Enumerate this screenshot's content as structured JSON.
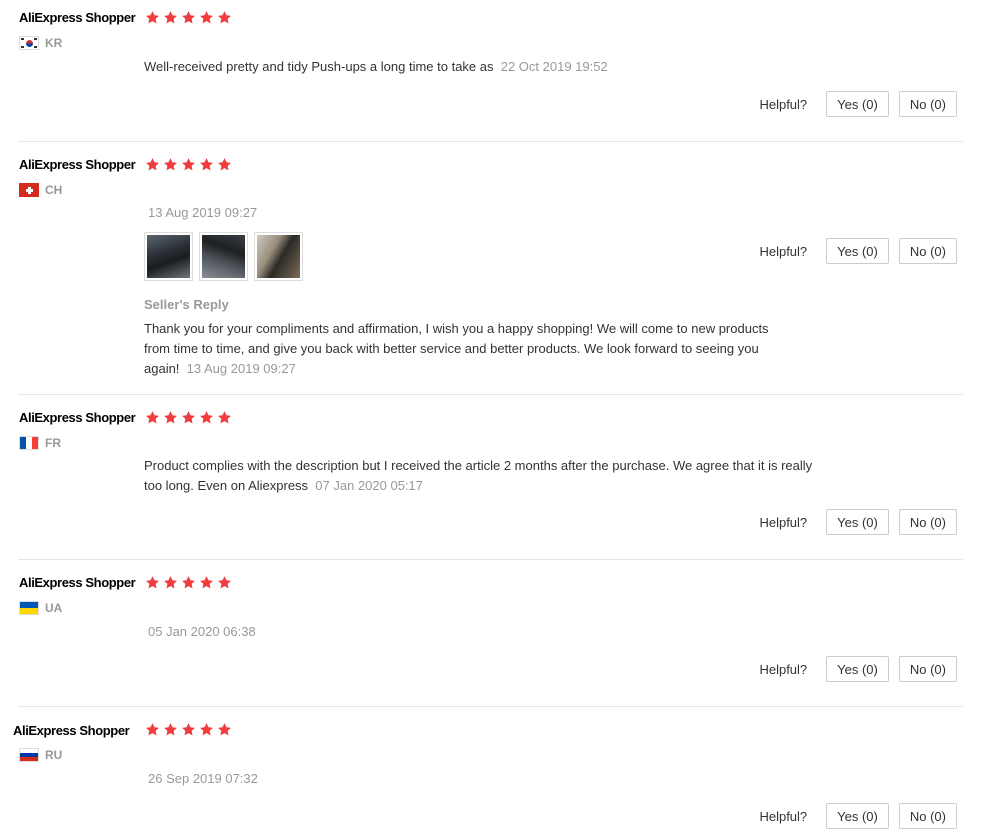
{
  "colors": {
    "star": "#f03c3c",
    "muted": "#999999"
  },
  "helpful_label": "Helpful?",
  "reviews": [
    {
      "name": "AliExpress Shopper",
      "rating": 5,
      "country": "KR",
      "flag_icon": "south-korea-flag-icon",
      "text": "Well-received pretty and tidy Push-ups a long time to take as",
      "date": "22 Oct 2019 19:52",
      "yes_label": "Yes (0)",
      "no_label": "No (0)"
    },
    {
      "name": "AliExpress Shopper",
      "rating": 5,
      "country": "CH",
      "flag_icon": "switzerland-flag-icon",
      "date": "13 Aug 2019 09:27",
      "photos": [
        "review-photo-1",
        "review-photo-2",
        "review-photo-3"
      ],
      "seller_reply_title": "Seller's Reply",
      "seller_reply_text_line1": "Thank you for your compliments and affirmation, I wish you a happy shopping! We will come to new products",
      "seller_reply_text_line2": "from time to time, and give you back with better service and better products. We look forward to seeing you",
      "seller_reply_text_line3": "again!",
      "seller_reply_date": "13 Aug 2019 09:27",
      "yes_label": "Yes (0)",
      "no_label": "No (0)"
    },
    {
      "name": "AliExpress Shopper",
      "rating": 5,
      "country": "FR",
      "flag_icon": "france-flag-icon",
      "text_line1": "Product complies with the description but I received the article 2 months after the purchase. We agree that it is really",
      "text_line2": "too long. Even on Aliexpress",
      "date": "07 Jan 2020 05:17",
      "yes_label": "Yes (0)",
      "no_label": "No (0)"
    },
    {
      "name": "AliExpress Shopper",
      "rating": 5,
      "country": "UA",
      "flag_icon": "ukraine-flag-icon",
      "date": "05 Jan 2020 06:38",
      "yes_label": "Yes (0)",
      "no_label": "No (0)"
    },
    {
      "name": "AliExpress Shopper",
      "rating": 5,
      "country": "RU",
      "flag_icon": "russia-flag-icon",
      "date": "26 Sep 2019 07:32",
      "yes_label": "Yes (0)",
      "no_label": "No (0)"
    }
  ]
}
